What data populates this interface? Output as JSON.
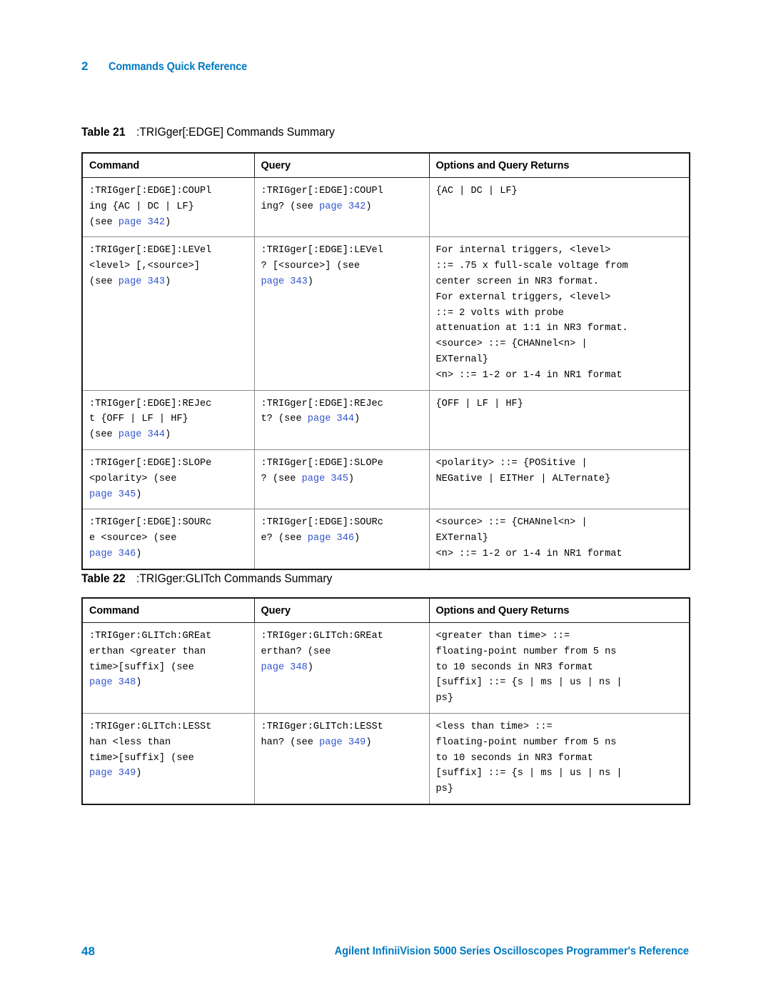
{
  "colors": {
    "accent_blue": "#0079c1",
    "link_blue": "#3355cc",
    "rule_dark": "#1a1a1a",
    "rule_light": "#8c8c8c"
  },
  "running_header": {
    "chapter_number": "2",
    "chapter_title": "Commands Quick Reference"
  },
  "footer": {
    "page_number": "48",
    "document_title": "Agilent InfiniiVision 5000 Series Oscilloscopes Programmer's Reference"
  },
  "tables": [
    {
      "caption_label": "Table 21",
      "caption_text": ":TRIGger[:EDGE] Commands Summary",
      "columns": [
        "Command",
        "Query",
        "Options and Query Returns"
      ],
      "rows": [
        {
          "command": [
            {
              "t": ":TRIGger[:EDGE]:COUPl\ning {AC | DC | LF}\n(see "
            },
            {
              "t": "page 342",
              "link": true
            },
            {
              "t": ")"
            }
          ],
          "query": [
            {
              "t": ":TRIGger[:EDGE]:COUPl\ning? (see "
            },
            {
              "t": "page 342",
              "link": true
            },
            {
              "t": ")"
            }
          ],
          "options": [
            {
              "t": "{AC | DC | LF}"
            }
          ]
        },
        {
          "command": [
            {
              "t": ":TRIGger[:EDGE]:LEVel\n<level> [,<source>]\n(see "
            },
            {
              "t": "page 343",
              "link": true
            },
            {
              "t": ")"
            }
          ],
          "query": [
            {
              "t": ":TRIGger[:EDGE]:LEVel\n? [<source>] (see\n"
            },
            {
              "t": "page 343",
              "link": true
            },
            {
              "t": ")"
            }
          ],
          "options": [
            {
              "t": "For internal triggers, <level>\n::= .75 x full-scale voltage from\ncenter screen in NR3 format.\nFor external triggers, <level>\n::= 2 volts with probe\nattenuation at 1:1 in NR3 format.\n<source> ::= {CHANnel<n> |\nEXTernal}\n<n> ::= 1-2 or 1-4 in NR1 format"
            }
          ]
        },
        {
          "command": [
            {
              "t": ":TRIGger[:EDGE]:REJec\nt {OFF | LF | HF}\n(see "
            },
            {
              "t": "page 344",
              "link": true
            },
            {
              "t": ")"
            }
          ],
          "query": [
            {
              "t": ":TRIGger[:EDGE]:REJec\nt? (see "
            },
            {
              "t": "page 344",
              "link": true
            },
            {
              "t": ")"
            }
          ],
          "options": [
            {
              "t": "{OFF | LF | HF}"
            }
          ]
        },
        {
          "command": [
            {
              "t": ":TRIGger[:EDGE]:SLOPe\n<polarity> (see\n"
            },
            {
              "t": "page 345",
              "link": true
            },
            {
              "t": ")"
            }
          ],
          "query": [
            {
              "t": ":TRIGger[:EDGE]:SLOPe\n? (see "
            },
            {
              "t": "page 345",
              "link": true
            },
            {
              "t": ")"
            }
          ],
          "options": [
            {
              "t": "<polarity> ::= {POSitive |\nNEGative | EITHer | ALTernate}"
            }
          ]
        },
        {
          "command": [
            {
              "t": ":TRIGger[:EDGE]:SOURc\ne <source> (see\n"
            },
            {
              "t": "page 346",
              "link": true
            },
            {
              "t": ")"
            }
          ],
          "query": [
            {
              "t": ":TRIGger[:EDGE]:SOURc\ne? (see "
            },
            {
              "t": "page 346",
              "link": true
            },
            {
              "t": ")"
            }
          ],
          "options": [
            {
              "t": "<source> ::= {CHANnel<n> |\nEXTernal}\n<n> ::= 1-2 or 1-4 in NR1 format"
            }
          ]
        }
      ]
    },
    {
      "caption_label": "Table 22",
      "caption_text": ":TRIGger:GLITch Commands Summary",
      "columns": [
        "Command",
        "Query",
        "Options and Query Returns"
      ],
      "rows": [
        {
          "command": [
            {
              "t": ":TRIGger:GLITch:GREat\nerthan <greater than\ntime>[suffix] (see\n"
            },
            {
              "t": "page 348",
              "link": true
            },
            {
              "t": ")"
            }
          ],
          "query": [
            {
              "t": ":TRIGger:GLITch:GREat\nerthan? (see\n"
            },
            {
              "t": "page 348",
              "link": true
            },
            {
              "t": ")"
            }
          ],
          "options": [
            {
              "t": "<greater than time> ::=\nfloating-point number from 5 ns\nto 10 seconds in NR3 format\n[suffix] ::= {s | ms | us | ns |\nps}"
            }
          ]
        },
        {
          "command": [
            {
              "t": ":TRIGger:GLITch:LESSt\nhan <less than\ntime>[suffix] (see\n"
            },
            {
              "t": "page 349",
              "link": true
            },
            {
              "t": ")"
            }
          ],
          "query": [
            {
              "t": ":TRIGger:GLITch:LESSt\nhan? (see "
            },
            {
              "t": "page 349",
              "link": true
            },
            {
              "t": ")"
            }
          ],
          "options": [
            {
              "t": "<less than time> ::=\nfloating-point number from 5 ns\nto 10 seconds in NR3 format\n[suffix] ::= {s | ms | us | ns |\nps}"
            }
          ]
        }
      ]
    }
  ]
}
